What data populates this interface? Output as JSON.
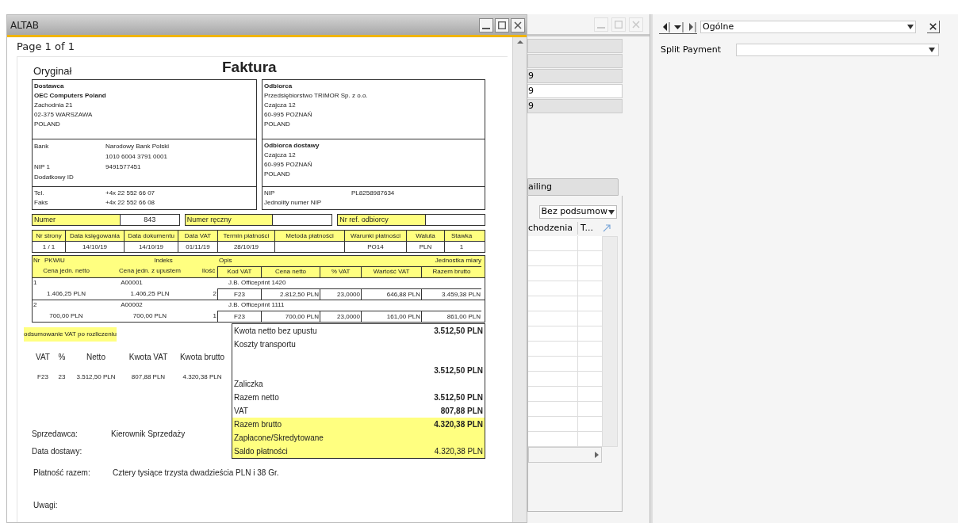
{
  "window": {
    "title": "ALTAB",
    "page_indicator": "Page 1 of 1"
  },
  "invoice": {
    "copy_label": "Oryginał",
    "title": "Faktura",
    "seller": {
      "heading": "Dostawca",
      "name": "OEC Computers Poland",
      "lines": [
        "Zachodnia 21",
        "02-375 WARSZAWA",
        "POLAND"
      ]
    },
    "bank": [
      {
        "label": "Bank",
        "values": [
          "Narodowy Bank Polski",
          "1010 6004 3791 0001"
        ]
      },
      {
        "label": "NIP 1",
        "values": [
          "9491577451"
        ]
      },
      {
        "label": "Dodatkowy ID"
      }
    ],
    "contact": [
      {
        "label": "Tel.",
        "value": "+4x 22 552 66 07"
      },
      {
        "label": "Faks",
        "value": "+4x 22 552 66 08"
      }
    ],
    "buyer": {
      "heading": "Odbiorca",
      "lines": [
        "Przedsiębiorstwo TRIMOR Sp. z o.o.",
        "Czajcza 12",
        "60-995 POZNAŃ",
        "POLAND"
      ]
    },
    "delivery": {
      "heading": "Odbiorca dostawy",
      "lines": [
        "Czajcza 12",
        "60-995 POZNAŃ",
        "POLAND"
      ]
    },
    "buyer_tax": [
      {
        "label": "NIP",
        "value": "PL8258987634"
      },
      {
        "label": "Jednolity numer NIP"
      }
    ],
    "refs": [
      {
        "label": "Numer",
        "value": "843"
      },
      {
        "label": "Numer ręczny"
      },
      {
        "label": "Nr ref. odbiorcy"
      }
    ],
    "doc_table": {
      "columns": [
        {
          "label": "Nr strony",
          "value": "1 / 1"
        },
        {
          "label": "Data księgowania",
          "value": "14/10/19"
        },
        {
          "label": "Data dokumentu",
          "value": "14/10/19"
        },
        {
          "label": "Data VAT",
          "value": "01/11/19"
        },
        {
          "label": "Termin płatności",
          "value": "28/10/19"
        },
        {
          "label": "Metoda płatności"
        },
        {
          "label": "Warunki płatności",
          "value": "PO14"
        },
        {
          "label": "Waluta",
          "value": "PLN"
        },
        {
          "label": "Stawka",
          "value": "1"
        }
      ]
    },
    "items_header": {
      "line1": [
        "Nr",
        "PKWiU",
        "Indeks",
        "Opis",
        "Jednostka miary"
      ],
      "line2": [
        "Cena jedn. netto",
        "Cena jedn. z upustem",
        "Ilość",
        "Kod VAT",
        "Cena netto",
        "% VAT",
        "Wartość VAT",
        "Razem brutto"
      ]
    },
    "items": [
      {
        "nr": "1",
        "index": "A00001",
        "description": "J.B. Officeprint 1420",
        "values": [
          "1.406,25 PLN",
          "1.406,25 PLN",
          "2",
          "F23",
          "2.812,50 PLN",
          "23,0000",
          "646,88 PLN",
          "3.459,38 PLN"
        ]
      },
      {
        "nr": "2",
        "index": "A00002",
        "description": "J.B. Officeprint 1111",
        "values": [
          "700,00 PLN",
          "700,00 PLN",
          "1",
          "F23",
          "700,00 PLN",
          "23,0000",
          "161,00 PLN",
          "861,00 PLN"
        ]
      }
    ],
    "vat_summary": {
      "title": "odsumowanie VAT po rozliczeniu",
      "columns": [
        "VAT",
        "%",
        "Netto",
        "Kwota VAT",
        "Kwota brutto"
      ],
      "rows": [
        [
          "F23",
          "23",
          "3.512,50 PLN",
          "807,88 PLN",
          "4.320,38 PLN"
        ]
      ]
    },
    "totals": [
      {
        "label": "Kwota netto bez upustu",
        "value": "3.512,50 PLN",
        "bold": true,
        "highlighted": false
      },
      {
        "label": "Koszty transportu",
        "highlighted": false
      },
      {
        "value": "3.512,50 PLN",
        "bold": true,
        "highlighted": false
      },
      {
        "label": "Zaliczka",
        "highlighted": false
      },
      {
        "label": "Razem netto",
        "value": "3.512,50 PLN",
        "bold": true,
        "highlighted": false
      },
      {
        "label": "VAT",
        "value": "807,88 PLN",
        "bold": true,
        "highlighted": false
      },
      {
        "label": "Razem brutto",
        "value": "4.320,38 PLN",
        "bold": true,
        "highlighted": true
      },
      {
        "label": "Zapłacone/Skredytowane",
        "highlighted": true
      },
      {
        "label": "Saldo płatności",
        "value": "4.320,38 PLN",
        "bold": false,
        "highlighted": true
      }
    ],
    "signatures": [
      {
        "label": "Sprzedawca:",
        "value": "Kierownik Sprzedaży"
      },
      {
        "label": "Data dostawy:"
      }
    ],
    "payment": {
      "label": "Płatność razem:",
      "value": "Cztery tysiące trzysta dwadzieścia PLN i 38 Gr."
    },
    "remarks": {
      "label": "Uwagi:"
    }
  },
  "middle_window": {
    "fields": [
      {
        "disabled": true
      },
      {
        "disabled": true
      },
      {
        "value": "9",
        "disabled": true
      },
      {
        "value": "9",
        "disabled": false
      },
      {
        "value": "9",
        "disabled": true
      }
    ],
    "tab": "ailing",
    "summary_dropdown": "Bez podsumow",
    "columns": [
      "chodzenia",
      "T..."
    ]
  },
  "right_panel": {
    "form": "Ogólne",
    "fields": [
      {
        "label": "Split Payment"
      }
    ]
  }
}
